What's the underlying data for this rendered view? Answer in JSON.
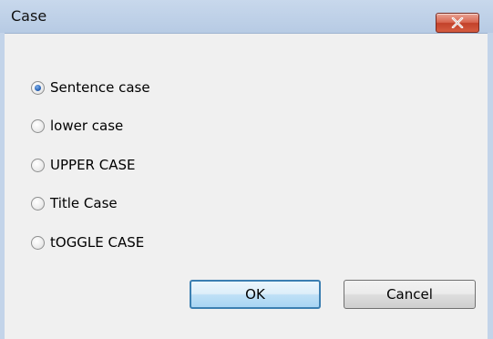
{
  "window": {
    "title": "Case",
    "close_icon": "close-icon"
  },
  "options": [
    {
      "label": "Sentence case",
      "checked": true
    },
    {
      "label": "lower case",
      "checked": false
    },
    {
      "label": "UPPER CASE",
      "checked": false
    },
    {
      "label": "Title Case",
      "checked": false
    },
    {
      "label": "tOGGLE CASE",
      "checked": false
    }
  ],
  "buttons": {
    "ok": "OK",
    "cancel": "Cancel"
  },
  "colors": {
    "titlebar": "#b7cbe4",
    "close": "#c2412a",
    "dialog_bg": "#f0f0f0",
    "default_button_border": "#3c7fb1"
  }
}
